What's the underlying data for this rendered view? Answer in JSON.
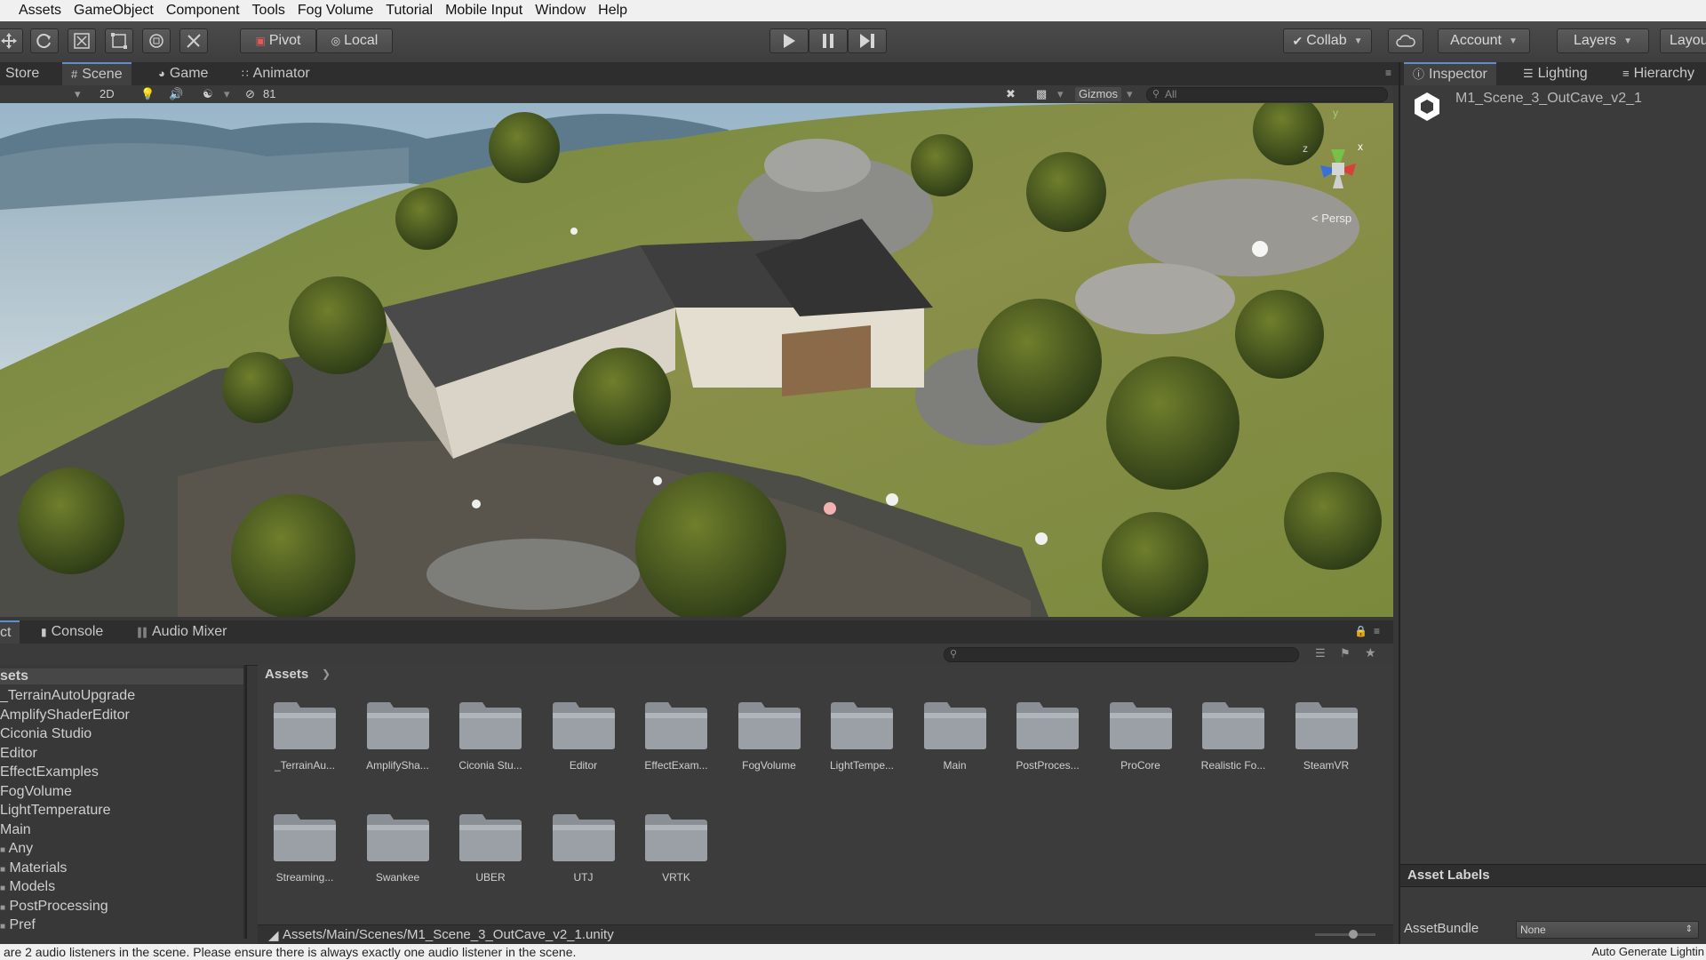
{
  "menu": [
    "Assets",
    "GameObject",
    "Component",
    "Tools",
    "Fog Volume",
    "Tutorial",
    "Mobile Input",
    "Window",
    "Help"
  ],
  "toolbar": {
    "pivot_label": "Pivot",
    "local_label": "Local",
    "collab_label": "Collab",
    "account_label": "Account",
    "layers_label": "Layers",
    "layout_label": "Layou"
  },
  "scene_tabs": {
    "store": "Store",
    "scene": "Scene",
    "game": "Game",
    "animator": "Animator"
  },
  "scene_toolbar": {
    "mode_2d": "2D",
    "hidden_count": "81",
    "gizmos_label": "Gizmos",
    "search_placeholder": "All"
  },
  "scene": {
    "gizmo_y": "y",
    "gizmo_x": "x",
    "gizmo_z": "z",
    "projection_label": "< Persp"
  },
  "right_tabs": {
    "inspector": "Inspector",
    "lighting": "Lighting",
    "hierarchy": "Hierarchy"
  },
  "inspector": {
    "object_name": "M1_Scene_3_OutCave_v2_1",
    "asset_labels": "Asset Labels",
    "assetbundle_label": "AssetBundle",
    "assetbundle_value": "None"
  },
  "bottom_tabs": {
    "project": "ct",
    "console": "Console",
    "audio_mixer": "Audio Mixer"
  },
  "tree": {
    "root": "sets",
    "items": [
      "_TerrainAutoUpgrade",
      "AmplifyShaderEditor",
      "Ciconia Studio",
      "Editor",
      "EffectExamples",
      "FogVolume",
      "LightTemperature",
      "Main",
      "Any",
      "Materials",
      "Models",
      "PostProcessing",
      "Pref"
    ]
  },
  "assets_breadcrumb": "Assets",
  "folders_row1": [
    "_TerrainAu...",
    "AmplifySha...",
    "Ciconia Stu...",
    "Editor",
    "EffectExam...",
    "FogVolume",
    "LightTempe...",
    "Main",
    "PostProces...",
    "ProCore",
    "Realistic Fo...",
    "SteamVR"
  ],
  "folders_row2": [
    "Streaming...",
    "Swankee",
    "UBER",
    "UTJ",
    "VRTK"
  ],
  "path": "Assets/Main/Scenes/M1_Scene_3_OutCave_v2_1.unity",
  "status": {
    "message": "are 2 audio listeners in the scene. Please ensure there is always exactly one audio listener in the scene.",
    "right": "Auto Generate Lightin"
  },
  "colors": {
    "accent": "#5a8fd6",
    "panel": "#383838",
    "menubar": "#f0f0f0"
  }
}
